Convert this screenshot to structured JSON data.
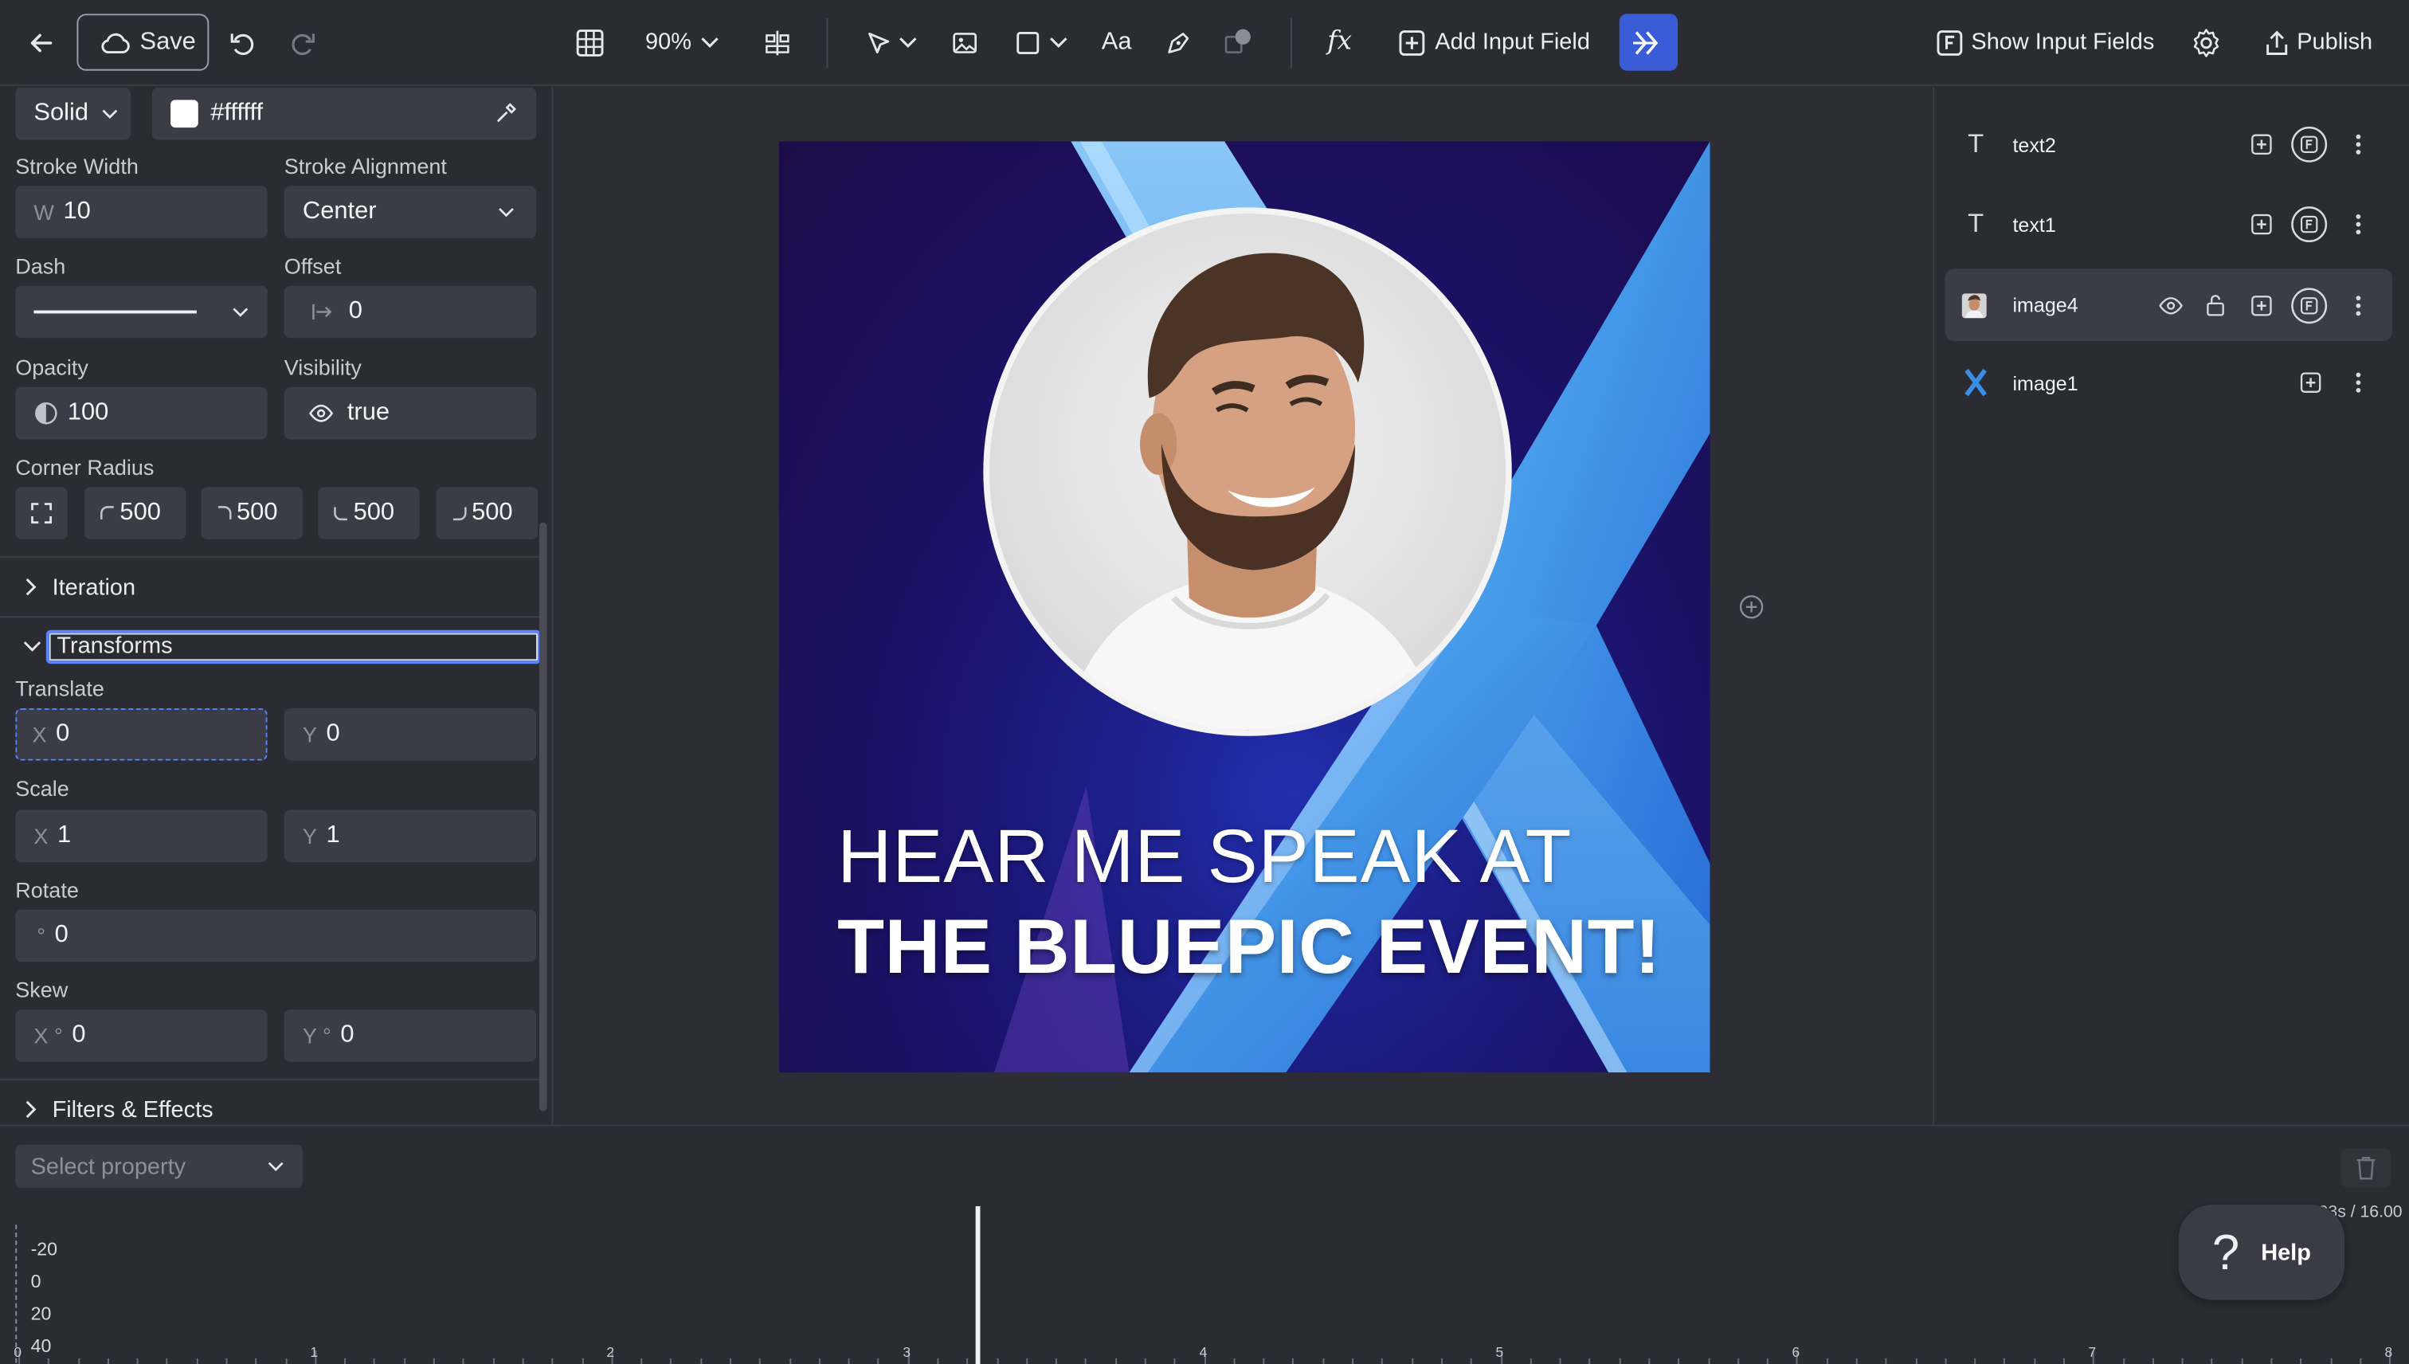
{
  "toolbar": {
    "save_label": "Save",
    "zoom": "90%",
    "add_input_label": "Add Input Field",
    "show_inputs_label": "Show Input Fields",
    "publish_label": "Publish",
    "fx_label": "fx",
    "text_tool_label": "Aa"
  },
  "fill": {
    "type": "Solid",
    "color": "#ffffff"
  },
  "stroke": {
    "width_label": "Stroke Width",
    "width_prefix": "W",
    "width_value": "10",
    "align_label": "Stroke Alignment",
    "align_value": "Center",
    "dash_label": "Dash",
    "offset_label": "Offset",
    "offset_value": "0"
  },
  "opacity": {
    "label": "Opacity",
    "value": "100"
  },
  "visibility": {
    "label": "Visibility",
    "value": "true"
  },
  "corner": {
    "label": "Corner Radius",
    "tl": "500",
    "tr": "500",
    "bl": "500",
    "br": "500"
  },
  "sections": {
    "iteration": "Iteration",
    "transforms": "Transforms",
    "filters": "Filters & Effects"
  },
  "transforms": {
    "translate_label": "Translate",
    "tx": "0",
    "ty": "0",
    "scale_label": "Scale",
    "sx": "1",
    "sy": "1",
    "rotate_label": "Rotate",
    "rotate": "0",
    "skew_label": "Skew",
    "kx": "0",
    "ky": "0",
    "x_prefix": "X",
    "y_prefix": "Y",
    "deg_x_prefix": "X °",
    "deg_y_prefix": "Y °",
    "deg_prefix": "°"
  },
  "artboard": {
    "line1": "HEAR ME SPEAK AT",
    "line2": "THE BLUEPIC EVENT!"
  },
  "layers": [
    {
      "name": "text2",
      "icon": "text-icon"
    },
    {
      "name": "text1",
      "icon": "text-icon"
    },
    {
      "name": "image4",
      "icon": "image-thumbnail-icon"
    },
    {
      "name": "image1",
      "icon": "logo-x-icon"
    }
  ],
  "timeline": {
    "select_placeholder": "Select property",
    "time": "7.93s / 16.00",
    "y_ticks": [
      "-20",
      "0",
      "20",
      "40"
    ],
    "x_ticks": [
      "0",
      "1",
      "2",
      "3",
      "4",
      "5",
      "6",
      "7",
      "8"
    ],
    "help_label": "Help"
  },
  "colors": {
    "accent": "#3a5cd6",
    "panel": "#2b2c33",
    "field": "#3b3c45"
  }
}
